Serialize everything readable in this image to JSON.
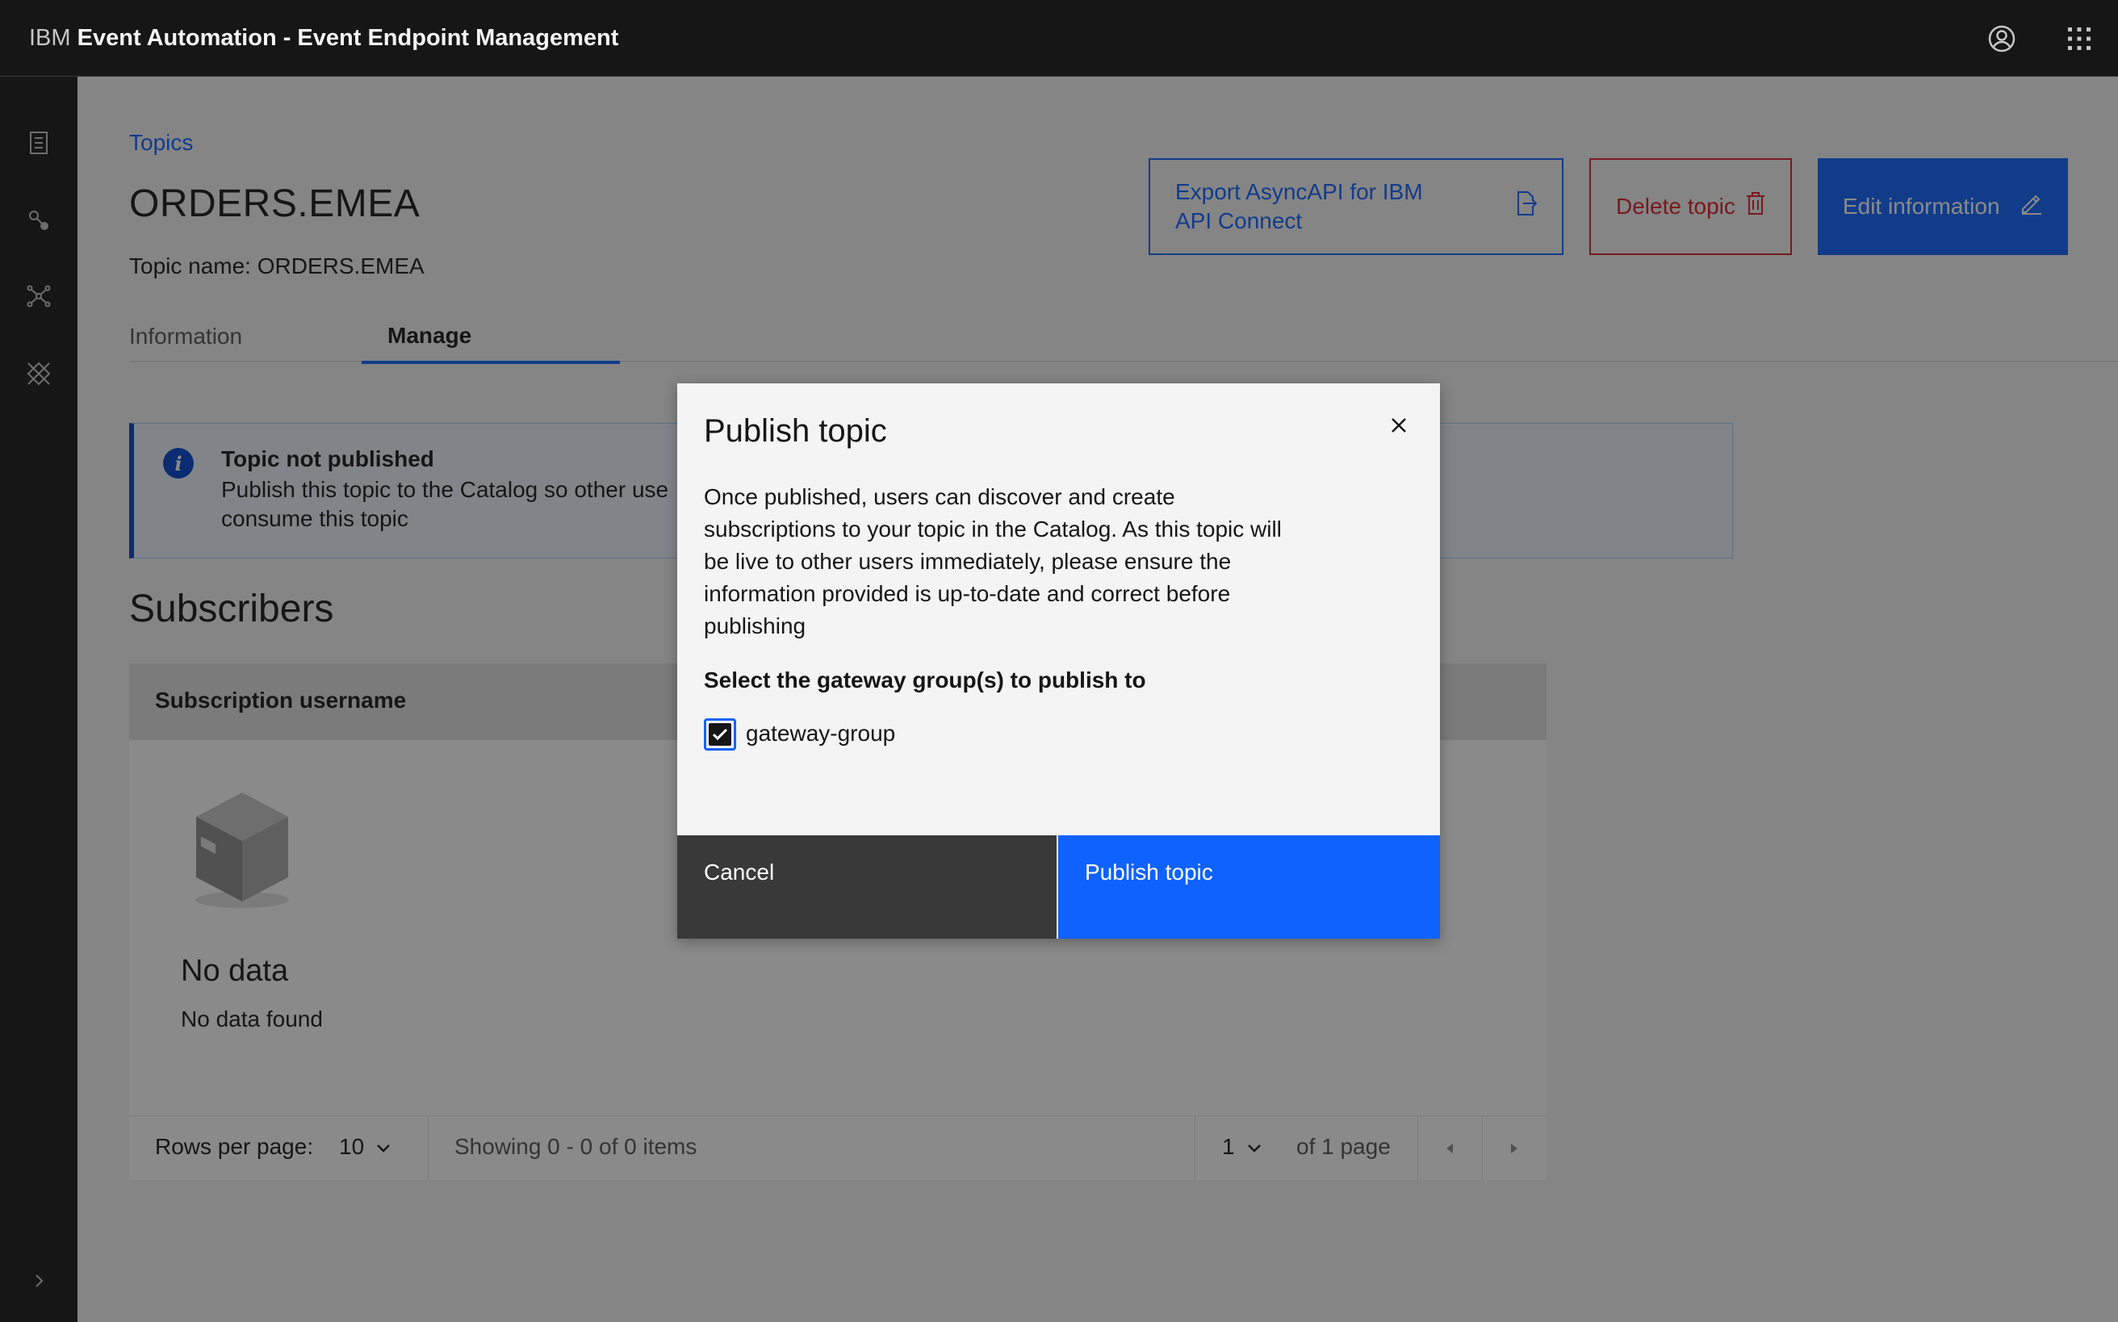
{
  "header": {
    "brand_prefix": "IBM",
    "brand_name": "Event Automation - Event Endpoint Management"
  },
  "sidenav": {
    "items": [
      "catalog-icon",
      "topics-icon",
      "gateways-icon",
      "integrations-icon"
    ],
    "expand_icon": "chevron-right-icon"
  },
  "page": {
    "breadcrumb": "Topics",
    "title": "ORDERS.EMEA",
    "subtitle": "Topic name: ORDERS.EMEA",
    "buttons": {
      "export": "Export AsyncAPI for IBM API Connect",
      "delete": "Delete topic",
      "edit": "Edit information"
    },
    "tabs": [
      "Information",
      "Manage"
    ],
    "active_tab": "Manage"
  },
  "notification": {
    "title": "Topic not published",
    "text": "Publish this topic to the Catalog so other use consume this topic",
    "line1": "Publish this topic to the Catalog so other use",
    "line2": "consume this topic"
  },
  "subscribers": {
    "heading": "Subscribers",
    "column": "Subscription username",
    "empty_title": "No data",
    "empty_text": "No data found",
    "pagination": {
      "rows_label": "Rows per page:",
      "rows_value": "10",
      "showing": "Showing 0 - 0 of 0 items",
      "page_value": "1",
      "of_pages": "of 1 page"
    }
  },
  "modal": {
    "title": "Publish topic",
    "body": "Once published, users can discover and create subscriptions to your topic in the Catalog. As this topic will be live to other users immediately, please ensure the information provided is up-to-date and correct before publishing",
    "group_label": "Select the gateway group(s) to publish to",
    "checkbox_label": "gateway-group",
    "checkbox_checked": true,
    "cancel": "Cancel",
    "publish": "Publish topic"
  },
  "colors": {
    "primary": "#0f62fe",
    "danger": "#da1e28",
    "header_bg": "#161616",
    "info": "#0043ce"
  }
}
